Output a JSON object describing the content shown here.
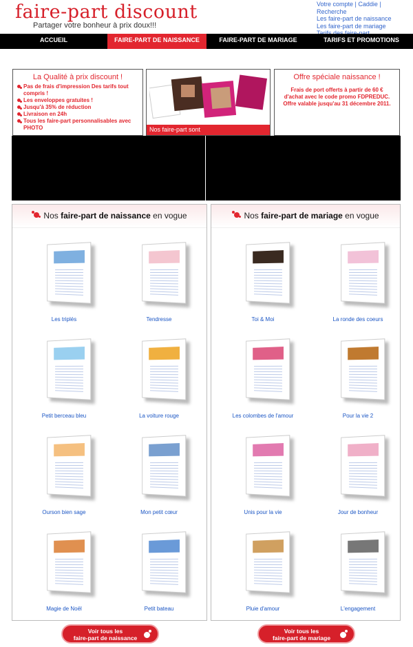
{
  "header": {
    "logo": "faire-part discount",
    "tagline": "Partager votre bonheur à prix doux!!!",
    "account_link": "Votre compte",
    "cart_link": "Caddie",
    "search_link": "Recherche",
    "links": [
      "Les faire-part de naissance",
      "Les faire-part de mariage",
      "Tarifs des faire-part"
    ]
  },
  "nav": [
    "ACCUEIL",
    "FAIRE-PART DE NAISSANCE",
    "FAIRE-PART DE MARIAGE",
    "TARIFS ET PROMOTIONS"
  ],
  "promo_left": {
    "title": "La Qualité à prix discount !",
    "items": [
      "Pas de frais d'impression Des tarifs tout compris !",
      "Les enveloppes gratuites !",
      "Jusqu'à 35% de réduction",
      "Livraison en 24h",
      "Tous les faire-part personnalisables avec PHOTO"
    ]
  },
  "promo_mid": {
    "caption": "Nos faire-part sont"
  },
  "promo_right": {
    "title": "Offre spéciale naissance !",
    "text": "Frais de port offerts à partir de 60 € d'achat avec le code promo FDPREDUC. Offre valable jusqu'au 31 décembre 2011."
  },
  "naissance": {
    "title_pre": "Nos ",
    "title_bold": "faire-part de naissance",
    "title_post": " en vogue",
    "items": [
      "Les triplés",
      "Tendresse",
      "Petit berceau bleu",
      "La voiture rouge",
      "Ourson bien sage",
      "Mon petit cœur",
      "Magie de Noël",
      "Petit bateau"
    ],
    "button": "Voir tous les\nfaire-part de naissance"
  },
  "mariage": {
    "title_pre": "Nos ",
    "title_bold": "faire-part de mariage",
    "title_post": " en vogue",
    "items": [
      "Toi & Moi",
      "La ronde des coeurs",
      "Les colombes de l'amour",
      "Pour la vie 2",
      "Unis pour la vie",
      "Jour de bonheur",
      "Pluie d'amour",
      "L'engagement"
    ],
    "button": "Voir tous les\nfaire-part de mariage"
  },
  "colors": {
    "brand_red": "#e2262f",
    "link_blue": "#1a55c4",
    "nav_black": "#000000"
  }
}
